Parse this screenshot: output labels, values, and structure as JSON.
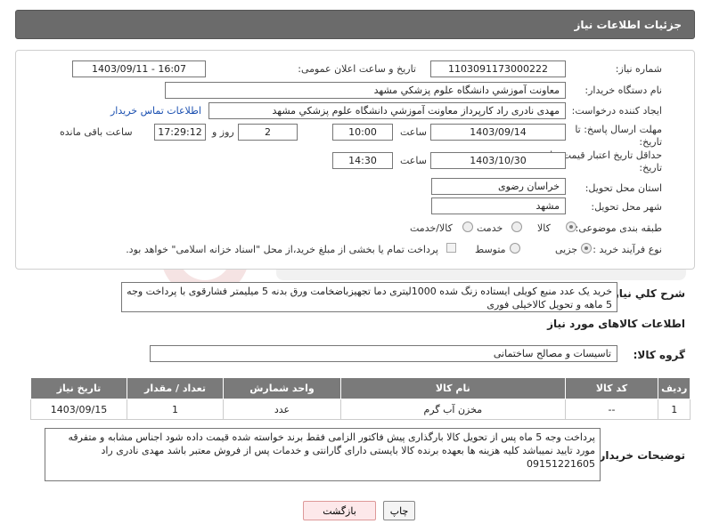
{
  "header": {
    "title": "جزئیات اطلاعات نیاز"
  },
  "labels": {
    "need_number": "شماره نیاز:",
    "announce_datetime": "تاریخ و ساعت اعلان عمومی:",
    "buyer_org": "نام دستگاه خریدار:",
    "requester": "ایجاد کننده درخواست:",
    "reply_deadline_1": "مهلت ارسال پاسخ: تا",
    "reply_deadline_2": "تاریخ:",
    "price_validity_1": "حداقل تاریخ اعتبار قیمت: تا",
    "price_validity_2": "تاریخ:",
    "hour": "ساعت",
    "day_and": "روز و",
    "remaining": "ساعت باقی مانده",
    "province": "استان محل تحویل:",
    "city": "شهر محل تحویل:",
    "category": "طبقه بندی موضوعی:",
    "purchase_type": "نوع فرآیند خرید :",
    "need_description": "شرح کلي نیاز:",
    "goods_info": "اطلاعات کالاهای مورد نیاز",
    "goods_group": "گروه کالا:",
    "buyer_notes": "توضیحات خریدار:"
  },
  "values": {
    "need_number": "1103091173000222",
    "announce_datetime": "1403/09/11 - 16:07",
    "buyer_org": "معاونت آموزشي دانشگاه علوم پزشكي مشهد",
    "requester": "مهدی نادری راد کارپرداز معاونت آموزشي دانشگاه علوم پزشكي مشهد",
    "contact_link": "اطلاعات تماس خریدار",
    "reply_date": "1403/09/14",
    "reply_time": "10:00",
    "days_left": "2",
    "time_left": "17:29:12",
    "validity_date": "1403/10/30",
    "validity_time": "14:30",
    "province": "خراسان رضوی",
    "city": "مشهد"
  },
  "category_options": [
    {
      "label": "کالا",
      "selected": true
    },
    {
      "label": "خدمت",
      "selected": false
    },
    {
      "label": "کالا/خدمت",
      "selected": false
    }
  ],
  "purchase_options": [
    {
      "label": "جزیی",
      "selected": true
    },
    {
      "label": "متوسط",
      "selected": false
    }
  ],
  "treasury_note": "پرداخت تمام یا بخشی از مبلغ خرید،از محل \"اسناد خزانه اسلامی\" خواهد بود.",
  "need_description": "خرید یک عدد منبع کویلی ایستاده زنگ شده 1000لیتری دما تجهیزباضخامت ورق بدنه 5 میلیمتر فشارقوی با پرداخت وجه 5 ماهه و تحویل کالاخیلی فوری",
  "goods_group": "تاسیسات و مصالح ساختمانی",
  "table": {
    "headers": [
      "ردیف",
      "کد کالا",
      "نام کالا",
      "واحد شمارش",
      "تعداد / مقدار",
      "تاریخ نیاز"
    ],
    "rows": [
      [
        "1",
        "--",
        "مخزن آب گرم",
        "عدد",
        "1",
        "1403/09/15"
      ]
    ]
  },
  "buyer_notes": "پرداخت وجه 5 ماه پس از تحویل کالا بارگذاری پیش فاکتور الزامی فقط برند خواسته شده قیمت داده شود اجناس مشابه و متفرقه مورد تایید نمیباشد کلیه هزینه ها بعهده برنده کالا بایستی دارای گارانتی و خدمات پس از فروش معتبر باشد مهدی نادری راد 09151221605",
  "buttons": {
    "print": "چاپ",
    "back": "بازگشت"
  },
  "colors": {
    "header_bg": "#6b6b6b",
    "table_header_bg": "#7a7a7a",
    "back_button_bg": "#fde8ea",
    "link": "#1a4fb0"
  }
}
